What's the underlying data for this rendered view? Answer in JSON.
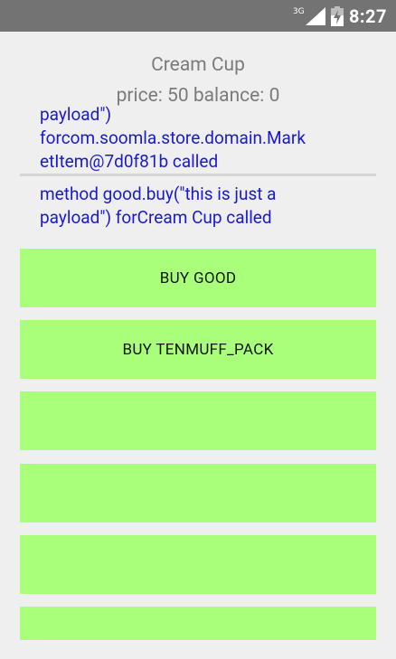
{
  "status_bar": {
    "network_type": "3G",
    "time": "8:27"
  },
  "header": {
    "title": "Cream Cup",
    "price_balance": "price: 50 balance: 0"
  },
  "log_lines": [
    "payload\")\nforcom.soomla.store.domain.Mark\netItem@7d0f81b called",
    "method good.buy(\"this is just a\npayload\") forCream Cup called"
  ],
  "buttons": {
    "buy_good": "BUY GOOD",
    "buy_tenmuff_pack": "BUY TENMUFF_PACK",
    "button3": "",
    "button4": "",
    "button5": "",
    "button6": ""
  },
  "colors": {
    "button_bg": "#a9ff7a",
    "log_text": "#1919d6",
    "status_bar": "#737373"
  }
}
